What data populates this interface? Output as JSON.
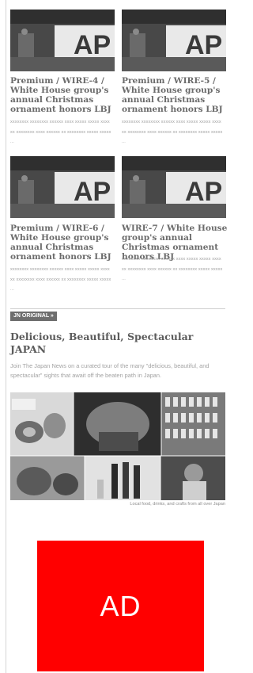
{
  "articles": [
    {
      "title": "Premium / WIRE-4 / White House group's annual Christmas ornament honors LBJ",
      "body": "xxxxxxxx xxxxxxxx xxxxxx xxxx xxxxx xxxxx xxxx xx xxxxxxxx xxxx xxxxxx xx xxxxxxxx xxxxx xxxxx ...",
      "thumb_text": "AP"
    },
    {
      "title": "Premium / WIRE-5 / White House group's annual Christmas ornament honors LBJ",
      "body": "xxxxxxxx xxxxxxxx xxxxxx xxxx xxxxx xxxxx xxxx xx xxxxxxxx xxxx xxxxxx xx xxxxxxxx xxxxx xxxxx ...",
      "thumb_text": "AP"
    },
    {
      "title": "Premium / WIRE-6 / White House group's annual Christmas ornament honors LBJ",
      "body": "xxxxxxxx xxxxxxxx xxxxxx xxxx xxxxx xxxxx xxxx xx xxxxxxxx xxxx xxxxxx xx xxxxxxxx xxxxx xxxxx ...",
      "thumb_text": "AP"
    },
    {
      "title": "WIRE-7 / White House group's annual Christmas ornament honors LBJ",
      "body": "xxxxxxxx xxxxxxxx xxxxxx xxxx xxxxx xxxxx xxxx xx xxxxxxxx xxxx xxxxxx xx xxxxxxxx xxxxx xxxxx ...",
      "thumb_text": "AP"
    }
  ],
  "feature": {
    "badge": "JN ORIGINAL »",
    "title": "Delicious, Beautiful, Spectacular JAPAN",
    "description": "Join The Japan News on a curated tour of the many \"delicious, beautiful, and spectacular\" sights that await off the beaten path in Japan.",
    "caption": "Local food, drinks, and crafts from all over Japan"
  },
  "ad": {
    "label": "AD",
    "color": "#ff0000"
  }
}
